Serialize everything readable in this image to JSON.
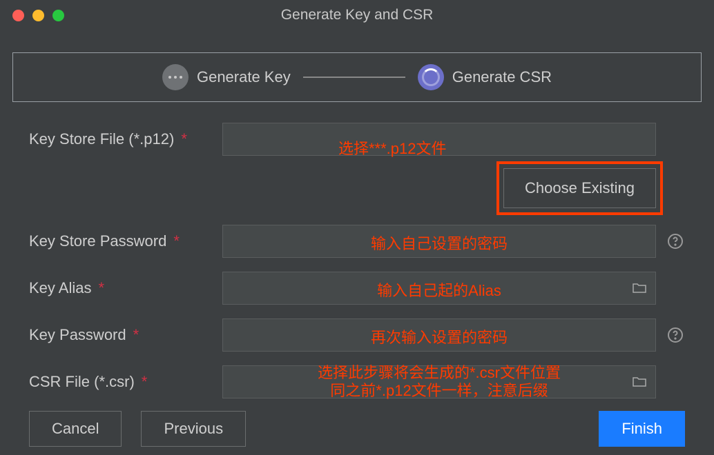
{
  "window": {
    "title": "Generate Key and CSR"
  },
  "stepper": {
    "step1": "Generate Key",
    "step2": "Generate CSR"
  },
  "form": {
    "keyStoreFile": {
      "label": "Key Store File (*.p12)"
    },
    "chooseExisting": {
      "label": "Choose Existing"
    },
    "keyStorePassword": {
      "label": "Key Store Password"
    },
    "keyAlias": {
      "label": "Key Alias"
    },
    "keyPassword": {
      "label": "Key Password"
    },
    "csrFile": {
      "label": "CSR File (*.csr)"
    },
    "required": "*"
  },
  "annotations": {
    "p12File": "选择***.p12文件",
    "storePwd": "输入自己设置的密码",
    "alias": "输入自己起的Alias",
    "keyPwd": "再次输入设置的密码",
    "csrLine1": "选择此步骤将会生成的*.csr文件位置",
    "csrLine2": "同之前*.p12文件一样，注意后缀"
  },
  "footer": {
    "cancel": "Cancel",
    "previous": "Previous",
    "finish": "Finish"
  },
  "colors": {
    "annotation": "#ff3b00",
    "primary": "#1a7cff",
    "stepActive": "#6c6fc9"
  }
}
